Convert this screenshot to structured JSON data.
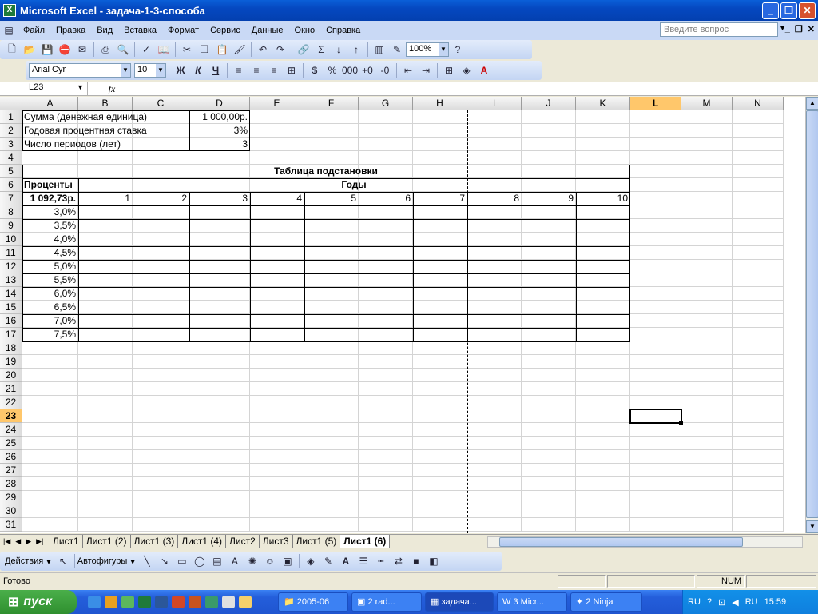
{
  "window": {
    "title": "Microsoft Excel - задача-1-3-способа",
    "app_icon": "excel-icon"
  },
  "menu": {
    "items": [
      "Файл",
      "Правка",
      "Вид",
      "Вставка",
      "Формат",
      "Сервис",
      "Данные",
      "Окно",
      "Справка"
    ],
    "ask_placeholder": "Введите вопрос"
  },
  "toolbar": {
    "zoom": "100%",
    "font": "Arial Cyr",
    "size": "10",
    "bold": "Ж",
    "italic": "К",
    "underline": "Ч"
  },
  "formula": {
    "namebox": "L23",
    "fx": "fx",
    "content": ""
  },
  "columns": [
    "A",
    "B",
    "C",
    "D",
    "E",
    "F",
    "G",
    "H",
    "I",
    "J",
    "K",
    "L",
    "M",
    "N"
  ],
  "rows": [
    "1",
    "2",
    "3",
    "4",
    "5",
    "6",
    "7",
    "8",
    "9",
    "10",
    "11",
    "12",
    "13",
    "14",
    "15",
    "16",
    "17",
    "18",
    "19",
    "20",
    "21",
    "22",
    "23",
    "24",
    "25",
    "26",
    "27",
    "28",
    "29",
    "30",
    "31"
  ],
  "cells": {
    "A1": "Сумма (денежная единица)",
    "D1": "1 000,00р.",
    "A2": "Годовая процентная ставка",
    "D2": "3%",
    "A3": "Число периодов (лет)",
    "D3": "3",
    "title": "Таблица подстановки",
    "A6": "Проценты",
    "years": "Годы",
    "A7": "1 092,73р.",
    "years_list": [
      "1",
      "2",
      "3",
      "4",
      "5",
      "6",
      "7",
      "8",
      "9",
      "10"
    ],
    "rates": [
      "3,0%",
      "3,5%",
      "4,0%",
      "4,5%",
      "5,0%",
      "5,5%",
      "6,0%",
      "6,5%",
      "7,0%",
      "7,5%"
    ]
  },
  "sheets": [
    "Лист1",
    "Лист1 (2)",
    "Лист1 (3)",
    "Лист1 (4)",
    "Лист2",
    "Лист3",
    "Лист1 (5)",
    "Лист1 (6)"
  ],
  "drawbar": {
    "actions": "Действия",
    "autoshapes": "Автофигуры"
  },
  "status": {
    "ready": "Готово",
    "num": "NUM"
  },
  "taskbar": {
    "start": "пуск",
    "buttons": [
      "2005-06",
      "2 rad...",
      "задача...",
      "3 Micr...",
      "2 Ninja"
    ],
    "lang": "RU",
    "time": "15:59"
  }
}
